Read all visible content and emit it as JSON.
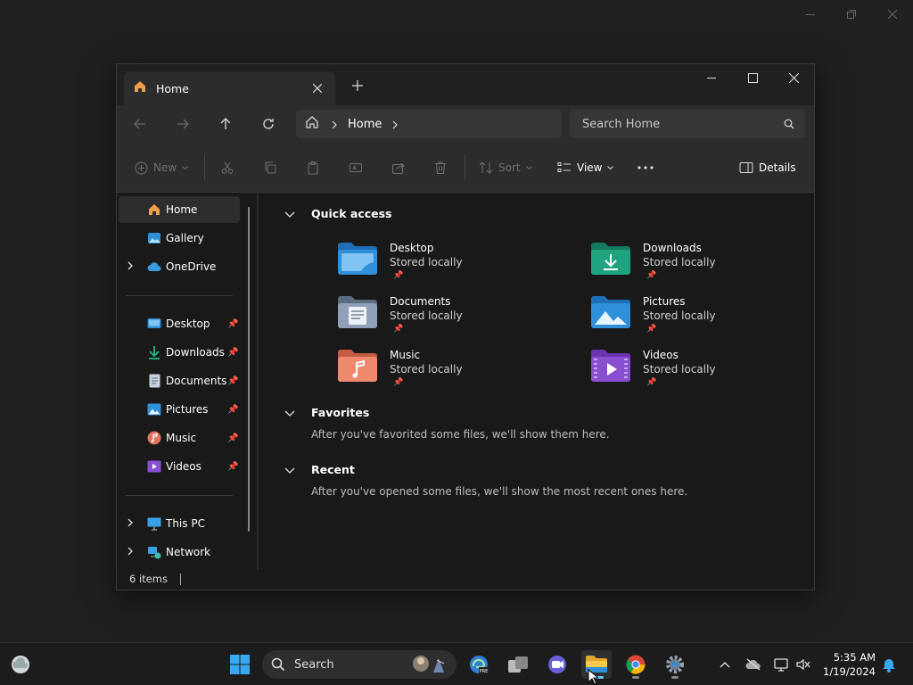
{
  "window": {
    "tab_title": "Home",
    "address": {
      "crumb": "Home"
    },
    "search_placeholder": "Search Home"
  },
  "toolbar": {
    "new_label": "New",
    "sort_label": "Sort",
    "view_label": "View",
    "details_label": "Details"
  },
  "sidebar": {
    "top": [
      {
        "label": "Home",
        "icon": "home-icon"
      },
      {
        "label": "Gallery",
        "icon": "gallery-icon"
      },
      {
        "label": "OneDrive",
        "icon": "cloud-icon"
      }
    ],
    "pinned": [
      {
        "label": "Desktop",
        "icon": "desktop-icon"
      },
      {
        "label": "Downloads",
        "icon": "download-icon"
      },
      {
        "label": "Documents",
        "icon": "document-icon"
      },
      {
        "label": "Pictures",
        "icon": "pictures-icon"
      },
      {
        "label": "Music",
        "icon": "music-icon"
      },
      {
        "label": "Videos",
        "icon": "videos-icon"
      }
    ],
    "bottom": [
      {
        "label": "This PC",
        "icon": "pc-icon"
      },
      {
        "label": "Network",
        "icon": "network-icon"
      }
    ]
  },
  "content": {
    "quick_access": {
      "title": "Quick access",
      "items": [
        {
          "name": "Desktop",
          "status": "Stored locally",
          "color": "#2f8fd8"
        },
        {
          "name": "Downloads",
          "status": "Stored locally",
          "color": "#1fa37f"
        },
        {
          "name": "Documents",
          "status": "Stored locally",
          "color": "#7f93b0"
        },
        {
          "name": "Pictures",
          "status": "Stored locally",
          "color": "#2f8fd8"
        },
        {
          "name": "Music",
          "status": "Stored locally",
          "color": "#e0735a"
        },
        {
          "name": "Videos",
          "status": "Stored locally",
          "color": "#8a4fd0"
        }
      ]
    },
    "favorites": {
      "title": "Favorites",
      "message": "After you've favorited some files, we'll show them here."
    },
    "recent": {
      "title": "Recent",
      "message": "After you've opened some files, we'll show the most recent ones here."
    }
  },
  "status": {
    "items": "6 items"
  },
  "taskbar": {
    "search_label": "Search",
    "time": "5:35 AM",
    "date": "1/19/2024"
  }
}
